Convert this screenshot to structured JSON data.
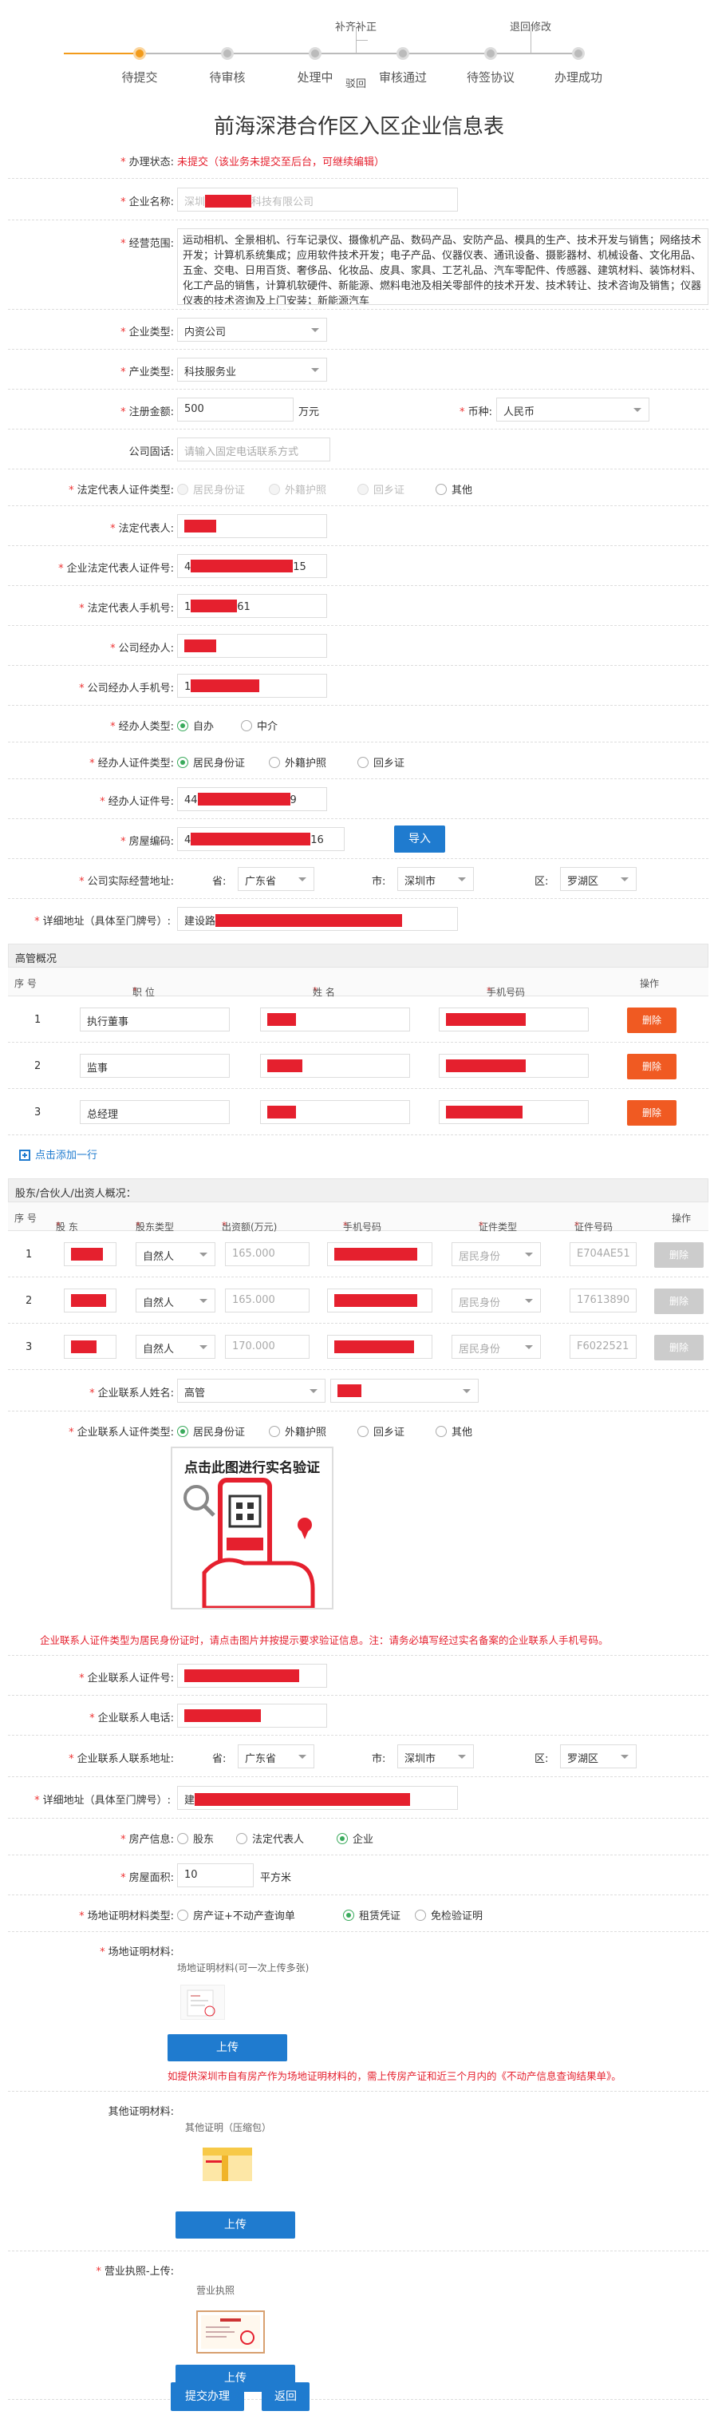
{
  "steps": [
    {
      "label": "待提交",
      "active": true
    },
    {
      "label": "待审核"
    },
    {
      "label": "处理中"
    },
    {
      "label": "审核通过"
    },
    {
      "label": "待签协议"
    },
    {
      "label": "办理成功"
    }
  ],
  "step_top": {
    "supplement": "补齐补正",
    "withdraw": "退回修改"
  },
  "step_mid": {
    "reject": "驳回"
  },
  "title": "前海深港合作区入区企业信息表",
  "status": {
    "label": "办理状态:",
    "value": "未提交（该业务未提交至后台，可继续编辑）"
  },
  "company_name": {
    "label": "企业名称:",
    "prefix": "深圳",
    "suffix": "科技有限公司"
  },
  "scope": {
    "label": "经营范围:",
    "text": "运动相机、全景相机、行车记录仪、摄像机产品、数码产品、安防产品、模具的生产、技术开发与销售；网络技术开发；计算机系统集成；应用软件技术开发；电子产品、仪器仪表、通讯设备、摄影器材、机械设备、文化用品、五金、交电、日用百货、奢侈品、化妆品、皮具、家具、工艺礼品、汽车零配件、传感器、建筑材料、装饰材料、化工产品的销售，计算机软硬件、新能源、燃料电池及相关零部件的技术开发、技术转让、技术咨询及销售；仪器仪表的技术咨询及上门安装；新能源汽车"
  },
  "enterprise_type": {
    "label": "企业类型:",
    "value": "内资公司"
  },
  "industry_type": {
    "label": "产业类型:",
    "value": "科技服务业"
  },
  "capital": {
    "label": "注册金额:",
    "value": "500",
    "unit": "万元",
    "currency_label": "币种:",
    "currency": "人民币"
  },
  "phone": {
    "label": "公司固话:",
    "placeholder": "请输入固定电话联系方式"
  },
  "legal_id_type": {
    "label": "法定代表人证件类型:",
    "options": [
      "居民身份证",
      "外籍护照",
      "回乡证",
      "其他"
    ]
  },
  "legal_name": {
    "label": "法定代表人:"
  },
  "legal_id": {
    "label": "企业法定代表人证件号:",
    "prefix": "4",
    "suffix": "15"
  },
  "legal_mobile": {
    "label": "法定代表人手机号:",
    "prefix": "1",
    "suffix": "61"
  },
  "agent_name": {
    "label": "公司经办人:"
  },
  "agent_mobile": {
    "label": "公司经办人手机号:",
    "prefix": "1"
  },
  "handler_type": {
    "label": "经办人类型:",
    "options": [
      "自办",
      "中介"
    ]
  },
  "handler_id_type": {
    "label": "经办人证件类型:",
    "options": [
      "居民身份证",
      "外籍护照",
      "回乡证"
    ]
  },
  "handler_id": {
    "label": "经办人证件号:",
    "prefix": "44",
    "suffix": "9"
  },
  "house_code": {
    "label": "房屋编码:",
    "prefix": "4",
    "suffix": "16",
    "button": "导入"
  },
  "office_address": {
    "label": "公司实际经营地址:",
    "province_label": "省:",
    "province": "广东省",
    "city_label": "市:",
    "city": "深圳市",
    "district_label": "区:",
    "district": "罗湖区"
  },
  "detail_address": {
    "label": "详细地址（具体至门牌号）:",
    "prefix": "建设路"
  },
  "exec_section": {
    "title": "高管概况",
    "headers": [
      "序 号",
      "职 位",
      "姓 名",
      "手机号码",
      "操作"
    ],
    "rows": [
      {
        "no": "1",
        "position": "执行董事",
        "action": "删除"
      },
      {
        "no": "2",
        "position": "监事",
        "action": "删除"
      },
      {
        "no": "3",
        "position": "总经理",
        "action": "删除"
      }
    ],
    "add_row": "点击添加一行"
  },
  "shareholder_section": {
    "title": "股东/合伙人/出资人概况：",
    "headers": [
      "序 号",
      "股 东",
      "股东类型",
      "出资额(万元)",
      "手机号码",
      "证件类型",
      "证件号码",
      "操作"
    ],
    "rows": [
      {
        "no": "1",
        "type": "自然人",
        "amount": "165.000",
        "id_type": "居民身份",
        "id_no": "E704AE51",
        "action": "删除"
      },
      {
        "no": "2",
        "type": "自然人",
        "amount": "165.000",
        "id_type": "居民身份",
        "id_no": "17613890",
        "action": "删除"
      },
      {
        "no": "3",
        "type": "自然人",
        "amount": "170.000",
        "id_type": "居民身份",
        "id_no": "F6022521",
        "action": "删除"
      }
    ]
  },
  "contact_name": {
    "label": "企业联系人姓名:",
    "value": "高管"
  },
  "contact_id_type": {
    "label": "企业联系人证件类型:",
    "options": [
      "居民身份证",
      "外籍护照",
      "回乡证",
      "其他"
    ]
  },
  "verify_card": {
    "title": "点击此图进行实名验证"
  },
  "verify_note": "企业联系人证件类型为居民身份证时，请点击图片并按提示要求验证信息。注：请务必填写经过实名备案的企业联系人手机号码。",
  "contact_id": {
    "label": "企业联系人证件号:"
  },
  "contact_phone": {
    "label": "企业联系人电话:"
  },
  "contact_address": {
    "label": "企业联系人联系地址:",
    "province_label": "省:",
    "province": "广东省",
    "city_label": "市:",
    "city": "深圳市",
    "district_label": "区:",
    "district": "罗湖区"
  },
  "contact_detail": {
    "label": "详细地址（具体至门牌号）:",
    "prefix": "建"
  },
  "property_info": {
    "label": "房产信息:",
    "options": [
      "股东",
      "法定代表人",
      "企业"
    ]
  },
  "property_area": {
    "label": "房屋面积:",
    "value": "10",
    "unit": "平方米"
  },
  "site_proof_type": {
    "label": "场地证明材料类型:",
    "options": [
      "房产证+不动产查询单",
      "租赁凭证",
      "免检验证明"
    ]
  },
  "site_proof": {
    "label": "场地证明材料:",
    "caption": "场地证明材料(可一次上传多张)",
    "button": "上传",
    "note": "如提供深圳市自有房产作为场地证明材料的，需上传房产证和近三个月内的《不动产信息查询结果单》。"
  },
  "other_proof": {
    "label": "其他证明材料:",
    "caption": "其他证明（压缩包）",
    "button": "上传"
  },
  "license": {
    "label": "营业执照-上传:",
    "caption": "营业执照",
    "button": "上传"
  },
  "footer": {
    "submit": "提交办理",
    "back": "返回"
  },
  "colors": {
    "accent": "#f29b1b",
    "primary": "#1f7bcf",
    "danger": "#e5202e",
    "delete": "#f05a22",
    "check": "#3aaa5c"
  }
}
